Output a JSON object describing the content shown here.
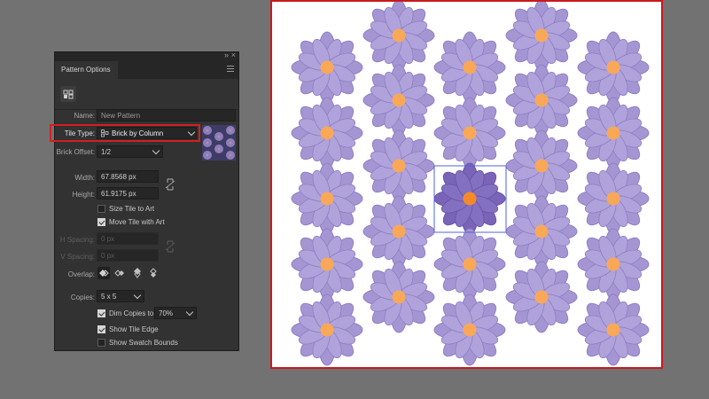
{
  "panel": {
    "title": "Pattern Options",
    "name_label": "Name:",
    "name_value": "New Pattern",
    "tile_type_label": "Tile Type:",
    "tile_type_value": "Brick by Column",
    "brick_offset_label": "Brick Offset:",
    "brick_offset_value": "1/2",
    "width_label": "Width:",
    "width_value": "67.8568 px",
    "height_label": "Height:",
    "height_value": "61.9175 px",
    "size_tile_label": "Size Tile to Art",
    "size_tile_checked": false,
    "move_tile_label": "Move Tile with Art",
    "move_tile_checked": true,
    "h_spacing_label": "H Spacing:",
    "h_spacing_value": "0 px",
    "v_spacing_label": "V Spacing:",
    "v_spacing_value": "0 px",
    "overlap_label": "Overlap:",
    "copies_label": "Copies:",
    "copies_value": "5 x 5",
    "dim_copies_label": "Dim Copies to:",
    "dim_copies_checked": true,
    "dim_copies_value": "70%",
    "show_tile_edge_label": "Show Tile Edge",
    "show_tile_edge_checked": true,
    "show_swatch_bounds_label": "Show Swatch Bounds",
    "show_swatch_bounds_checked": false
  },
  "colors": {
    "petal": "#a596d3",
    "petal_dark": "#8b79c4",
    "petal_selected": "#7a64b8",
    "center": "#f9a858",
    "tile_edge": "#4f63d9",
    "highlight": "#d21f1f"
  }
}
